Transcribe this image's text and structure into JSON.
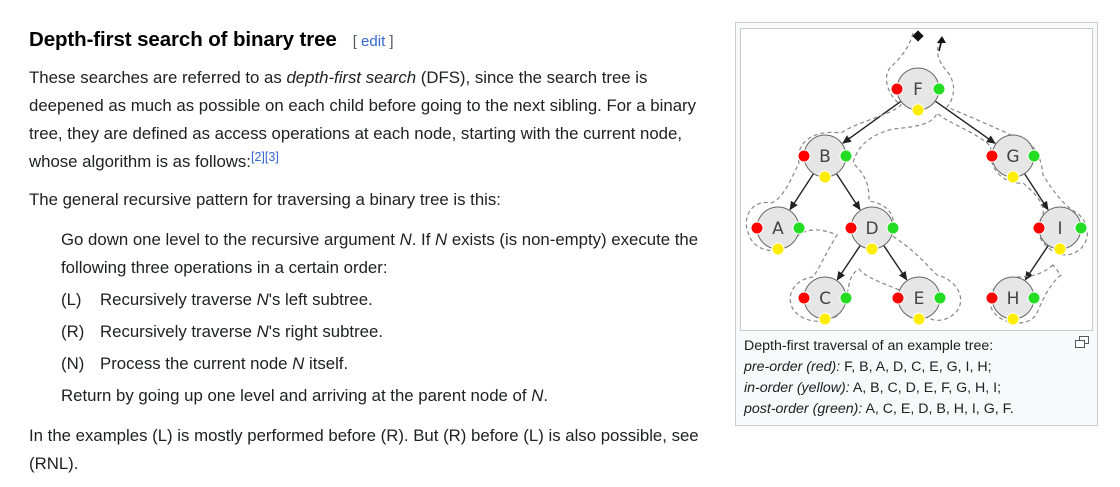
{
  "section": {
    "title": "Depth-first search of binary tree",
    "edit_open": "[ ",
    "edit_label": "edit",
    "edit_close": " ]"
  },
  "intro": {
    "t1": "These searches are referred to as ",
    "t2": "depth-first search",
    "t3": " (DFS), since the search tree is deepened as much as possible on each child before going to the next sibling. For a binary tree, they are defined as access operations at each node, starting with the current node, whose algorithm is as follows:",
    "ref1": "[2]",
    "ref2": "[3]"
  },
  "pattern_text": "The general recursive pattern for traversing a binary tree is this:",
  "steps": {
    "s1": "Go down one level to the recursive argument ",
    "s2": "N",
    "s3": ". If ",
    "s4": "N",
    "s5": " exists (is non-empty) execute the following three operations in a certain order:",
    "ops": [
      {
        "tag": "(L)",
        "a": "Recursively traverse ",
        "n": "N",
        "b": "'s left subtree."
      },
      {
        "tag": "(R)",
        "a": "Recursively traverse ",
        "n": "N",
        "b": "'s right subtree."
      },
      {
        "tag": "(N)",
        "a": "Process the current node ",
        "n": "N",
        "b": " itself."
      }
    ],
    "ret_a": "Return by going up one level and arriving at the parent node of ",
    "ret_n": "N",
    "ret_b": "."
  },
  "outro": "In the examples (L) is mostly performed before (R). But (R) before (L) is also possible, see (RNL).",
  "figure": {
    "nodes": [
      "F",
      "B",
      "G",
      "A",
      "D",
      "I",
      "C",
      "E",
      "H"
    ],
    "caption_line1": "Depth-first traversal of an example tree:",
    "pre_label": "pre-order (red):",
    "pre_value": " F, B, A, D, C, E, G, I, H;",
    "in_label": "in-order (yellow):",
    "in_value": " A, B, C, D, E, F, G, H, I;",
    "post_label": "post-order (green):",
    "post_value": " A, C, E, D, B, H, I, G, F.",
    "colors": {
      "pre": "#ff0000",
      "in": "#ffee00",
      "post": "#22dd22",
      "node_fill": "#e6e6e6",
      "path": "#888888"
    }
  }
}
